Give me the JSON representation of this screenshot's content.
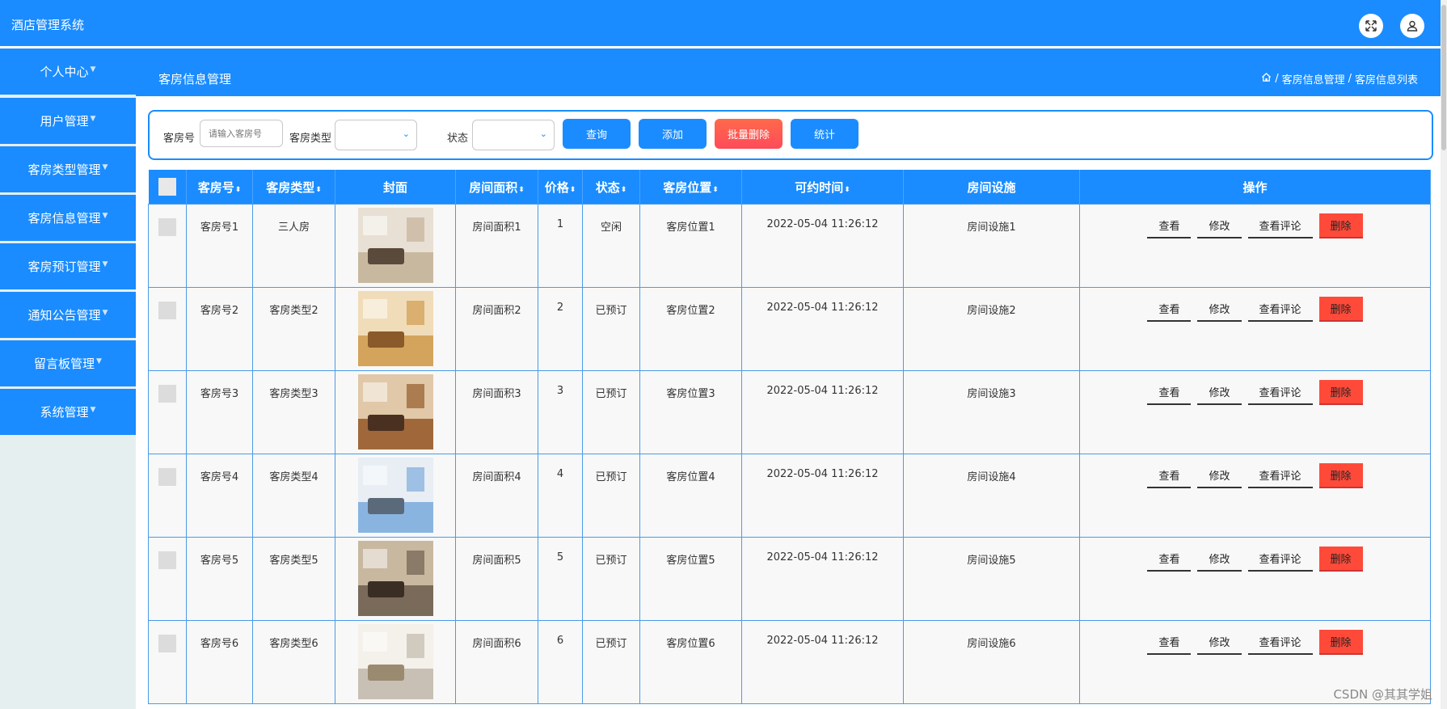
{
  "app": {
    "title": "酒店管理系统"
  },
  "icons": {
    "fullscreen": "fullscreen-icon",
    "user": "user-icon",
    "home": "home-icon"
  },
  "sidebar": {
    "items": [
      {
        "label": "个人中心"
      },
      {
        "label": "用户管理"
      },
      {
        "label": "客房类型管理"
      },
      {
        "label": "客房信息管理"
      },
      {
        "label": "客房预订管理"
      },
      {
        "label": "通知公告管理"
      },
      {
        "label": "留言板管理"
      },
      {
        "label": "系统管理"
      }
    ]
  },
  "header": {
    "page_title": "客房信息管理",
    "breadcrumb": [
      "客房信息管理",
      "客房信息列表"
    ]
  },
  "search": {
    "room_no_label": "客房号",
    "room_no_placeholder": "请输入客房号",
    "room_type_label": "客房类型",
    "room_type_value": "",
    "status_label": "状态",
    "status_value": "",
    "buttons": {
      "query": "查询",
      "add": "添加",
      "batch_delete": "批量删除",
      "stats": "统计"
    }
  },
  "table": {
    "columns": {
      "room_no": "客房号",
      "room_type": "客房类型",
      "cover": "封面",
      "area": "房间面积",
      "price": "价格",
      "status": "状态",
      "location": "客房位置",
      "available_time": "可约时间",
      "facilities": "房间设施",
      "actions": "操作"
    },
    "actions": {
      "view": "查看",
      "edit": "修改",
      "view_comments": "查看评论",
      "delete": "删除"
    },
    "rows": [
      {
        "room_no": "客房号1",
        "room_type": "三人房",
        "area": "房间面积1",
        "price": "1",
        "status": "空闲",
        "location": "客房位置1",
        "available_time": "2022-05-04 11:26:12",
        "facilities": "房间设施1"
      },
      {
        "room_no": "客房号2",
        "room_type": "客房类型2",
        "area": "房间面积2",
        "price": "2",
        "status": "已预订",
        "location": "客房位置2",
        "available_time": "2022-05-04 11:26:12",
        "facilities": "房间设施2"
      },
      {
        "room_no": "客房号3",
        "room_type": "客房类型3",
        "area": "房间面积3",
        "price": "3",
        "status": "已预订",
        "location": "客房位置3",
        "available_time": "2022-05-04 11:26:12",
        "facilities": "房间设施3"
      },
      {
        "room_no": "客房号4",
        "room_type": "客房类型4",
        "area": "房间面积4",
        "price": "4",
        "status": "已预订",
        "location": "客房位置4",
        "available_time": "2022-05-04 11:26:12",
        "facilities": "房间设施4"
      },
      {
        "room_no": "客房号5",
        "room_type": "客房类型5",
        "area": "房间面积5",
        "price": "5",
        "status": "已预订",
        "location": "客房位置5",
        "available_time": "2022-05-04 11:26:12",
        "facilities": "房间设施5"
      },
      {
        "room_no": "客房号6",
        "room_type": "客房类型6",
        "area": "房间面积6",
        "price": "6",
        "status": "已预订",
        "location": "客房位置6",
        "available_time": "2022-05-04 11:26:12",
        "facilities": "房间设施6"
      }
    ]
  },
  "watermark": "CSDN @其其学姐",
  "colors": {
    "primary": "#1a8cff",
    "danger": "#ff4a3a",
    "sidebar_bg": "#e6efef"
  }
}
